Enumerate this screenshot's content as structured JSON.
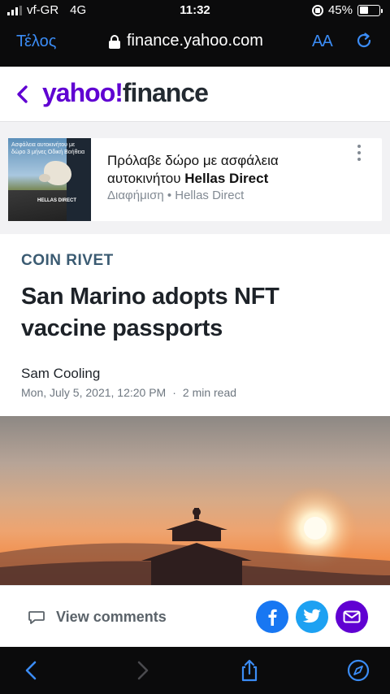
{
  "status_bar": {
    "carrier": "vf-GR",
    "network": "4G",
    "time": "11:32",
    "battery_text": "45%",
    "battery_level": 0.45
  },
  "browser": {
    "done_label": "Τέλος",
    "url": "finance.yahoo.com",
    "text_size_label": "AA",
    "icons": [
      "padlock-icon",
      "reload-icon"
    ]
  },
  "site_header": {
    "logo_yahoo": "yahoo!",
    "logo_finance": "finance",
    "brand_color": "#6001d2"
  },
  "ad": {
    "title_prefix": "Πρόλαβε δώρο με ασφάλεια αυτοκινήτου ",
    "title_brand": "Hellas Direct",
    "meta": "Διαφήμιση • Hellas Direct",
    "thumb_text": "Ασφάλεια αυτοκινήτου με δώρο 3 μήνες Οδική Βοήθεια",
    "thumb_brand": "HELLAS DIRECT"
  },
  "article": {
    "publisher": "COIN RIVET",
    "headline": "San Marino adopts NFT vaccine passports",
    "author": "Sam Cooling",
    "date": "Mon, July 5, 2021, 12:20 PM",
    "separator": "·",
    "read_time": "2 min read"
  },
  "comments_bar": {
    "view_comments_label": "View comments",
    "share_colors": {
      "facebook": "#1877f2",
      "twitter": "#1da1f2",
      "mail": "#6001d2"
    }
  },
  "toolbar": {
    "icons": [
      "back-arrow-icon",
      "forward-arrow-icon",
      "share-icon",
      "compass-icon"
    ],
    "accent": "#3b8cf5"
  }
}
